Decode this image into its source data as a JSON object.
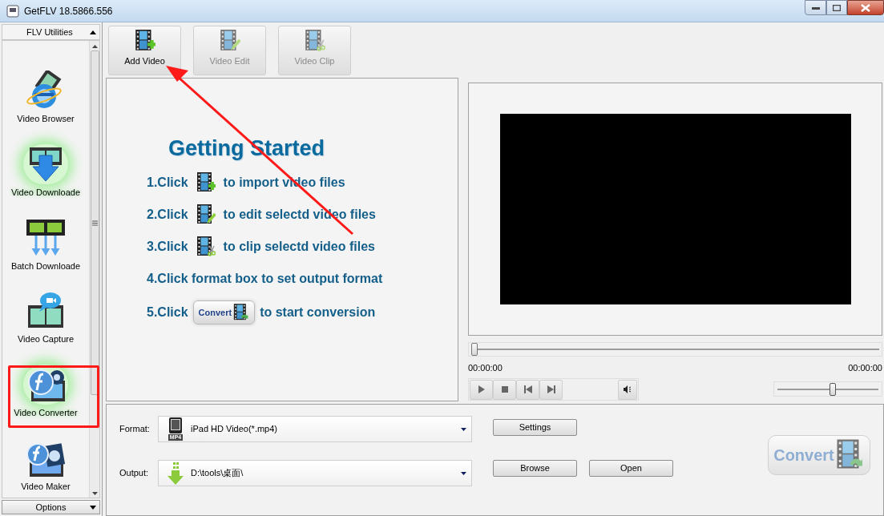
{
  "window": {
    "title": "GetFLV 18.5866.556"
  },
  "sidebar": {
    "header": "FLV Utilities",
    "items": [
      {
        "label": "Video Browser",
        "kind": "browser",
        "glow": false
      },
      {
        "label": "Video Downloade",
        "kind": "download",
        "glow": true
      },
      {
        "label": "Batch Downloade",
        "kind": "batch",
        "glow": false
      },
      {
        "label": "Video Capture",
        "kind": "capture",
        "glow": false
      },
      {
        "label": "Video Converter",
        "kind": "converter",
        "glow": true
      },
      {
        "label": "Video Maker",
        "kind": "maker",
        "glow": false
      }
    ],
    "options": "Options"
  },
  "toolbar": [
    {
      "label": "Add Video",
      "kind": "add",
      "disabled": false
    },
    {
      "label": "Video Edit",
      "kind": "edit",
      "disabled": true
    },
    {
      "label": "Video Clip",
      "kind": "clip",
      "disabled": true
    }
  ],
  "getting_started": {
    "title": "Getting Started",
    "steps": [
      {
        "kind": "icon",
        "lead": "1.Click",
        "text": "to import video files"
      },
      {
        "kind": "icon",
        "lead": "2.Click",
        "text": "to edit selectd video files"
      },
      {
        "kind": "icon",
        "lead": "3.Click",
        "text": "to clip selectd video files"
      },
      {
        "kind": "plain",
        "text": "4.Click format box to set output format"
      },
      {
        "kind": "button",
        "lead": "5.Click",
        "button": "Convert",
        "text": "to start conversion"
      }
    ]
  },
  "player": {
    "seek": {
      "level": 0
    },
    "time_start": "00:00:00",
    "time_end": "00:00:00",
    "volume": {
      "level": 0.55
    }
  },
  "output_panel": {
    "format_label": "Format:",
    "format_value": "iPad HD Video(*.mp4)",
    "format_badge": "MP4",
    "output_label": "Output:",
    "output_value": "D:\\tools\\桌面\\",
    "settings": "Settings",
    "browse": "Browse",
    "open": "Open",
    "convert": {
      "label": "Convert",
      "disabled": true
    }
  }
}
